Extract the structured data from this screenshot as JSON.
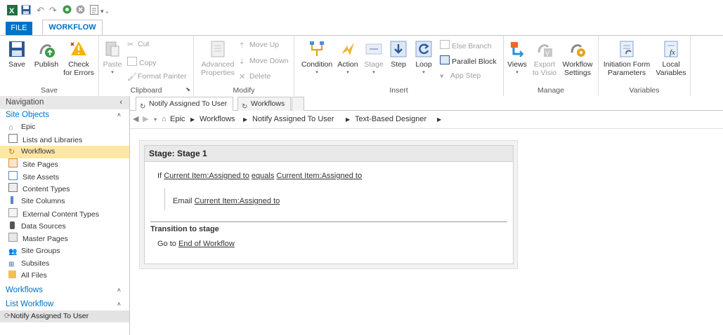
{
  "qat": {
    "icons": [
      "excel-icon",
      "save-icon",
      "undo-icon",
      "redo-icon",
      "publish-icon",
      "stop-icon",
      "page-icon",
      "customize-icon"
    ]
  },
  "tabs": {
    "file": "FILE",
    "workflow": "WORKFLOW"
  },
  "ribbon": {
    "save_group": {
      "label": "Save",
      "save": "Save",
      "publish": "Publish",
      "check_line1": "Check",
      "check_line2": "for Errors"
    },
    "clipboard": {
      "label": "Clipboard",
      "paste": "Paste",
      "cut": "Cut",
      "copy": "Copy",
      "format_painter": "Format Painter"
    },
    "modify": {
      "label": "Modify",
      "advanced_line1": "Advanced",
      "advanced_line2": "Properties",
      "move_up": "Move Up",
      "move_down": "Move Down",
      "delete": "Delete"
    },
    "insert": {
      "label": "Insert",
      "condition": "Condition",
      "action": "Action",
      "stage": "Stage",
      "step": "Step",
      "loop": "Loop",
      "else_branch": "Else Branch",
      "parallel_block": "Parallel Block",
      "app_step": "App Step"
    },
    "manage": {
      "label": "Manage",
      "views": "Views",
      "export_line1": "Export",
      "export_line2": "to Visio",
      "settings_line1": "Workflow",
      "settings_line2": "Settings"
    },
    "variables": {
      "label": "Variables",
      "init_line1": "Initiation Form",
      "init_line2": "Parameters",
      "local_line1": "Local",
      "local_line2": "Variables"
    }
  },
  "nav": {
    "header": "Navigation",
    "site_objects": "Site Objects",
    "items": [
      {
        "label": "Epic",
        "icon": "home-icon"
      },
      {
        "label": "Lists and Libraries",
        "icon": "list-icon"
      },
      {
        "label": "Workflows",
        "icon": "workflow-icon"
      },
      {
        "label": "Site Pages",
        "icon": "pages-icon"
      },
      {
        "label": "Site Assets",
        "icon": "assets-icon"
      },
      {
        "label": "Content Types",
        "icon": "content-types-icon"
      },
      {
        "label": "Site Columns",
        "icon": "columns-icon"
      },
      {
        "label": "External Content Types",
        "icon": "external-icon"
      },
      {
        "label": "Data Sources",
        "icon": "data-icon"
      },
      {
        "label": "Master Pages",
        "icon": "master-icon"
      },
      {
        "label": "Site Groups",
        "icon": "groups-icon"
      },
      {
        "label": "Subsites",
        "icon": "subsites-icon"
      },
      {
        "label": "All Files",
        "icon": "folder-icon"
      }
    ],
    "workflows_section": "Workflows",
    "list_workflow_section": "List Workflow",
    "list_workflow_item": "Notify Assigned To User"
  },
  "doc_tabs": {
    "active": "Notify Assigned To User",
    "second": "Workflows"
  },
  "breadcrumb": {
    "items": [
      "Epic",
      "Workflows",
      "Notify Assigned To User",
      "Text-Based Designer"
    ]
  },
  "designer": {
    "stage_title": "Stage: Stage 1",
    "if_word": "If",
    "cond_left": "Current Item:Assigned to",
    "cond_op": "equals",
    "cond_right": "Current Item:Assigned to",
    "email_word": "Email",
    "email_target": "Current Item:Assigned to",
    "transition_title": "Transition to stage",
    "goto_word": "Go to",
    "goto_target": "End of Workflow"
  }
}
